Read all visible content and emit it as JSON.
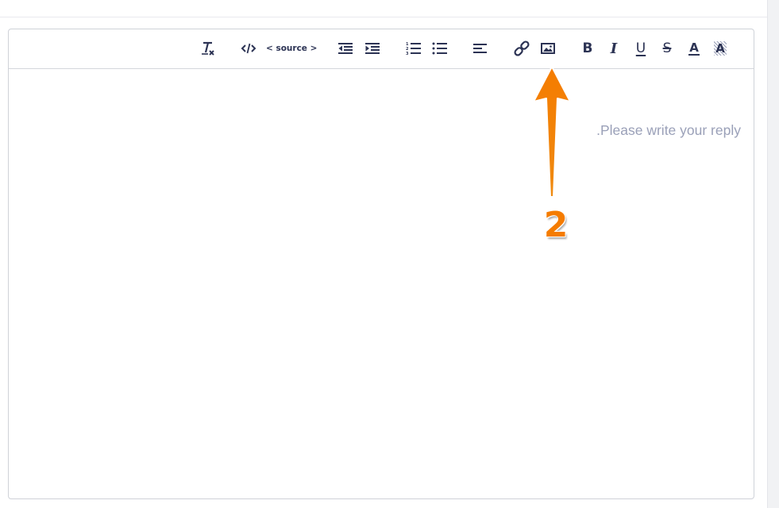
{
  "editor": {
    "placeholder": ".Please write your reply",
    "toolbar": {
      "source_label": "< source >",
      "buttons": [
        "clear-formatting",
        "code-block",
        "source",
        "outdent",
        "indent",
        "ordered-list",
        "bullet-list",
        "align",
        "link",
        "image",
        "bold",
        "italic",
        "underline",
        "strikethrough",
        "text-color",
        "background-color"
      ],
      "bold_glyph": "B",
      "italic_glyph": "I",
      "underline_glyph": "U",
      "strike_glyph": "S",
      "color_glyph": "A",
      "bgcolor_glyph": "A"
    }
  },
  "annotation": {
    "step_number": "2",
    "arrow_color": "#f57c00"
  },
  "colors": {
    "icon": "#2c3354",
    "placeholder": "#9aa0b8",
    "accent_orange": "#f57c00"
  }
}
